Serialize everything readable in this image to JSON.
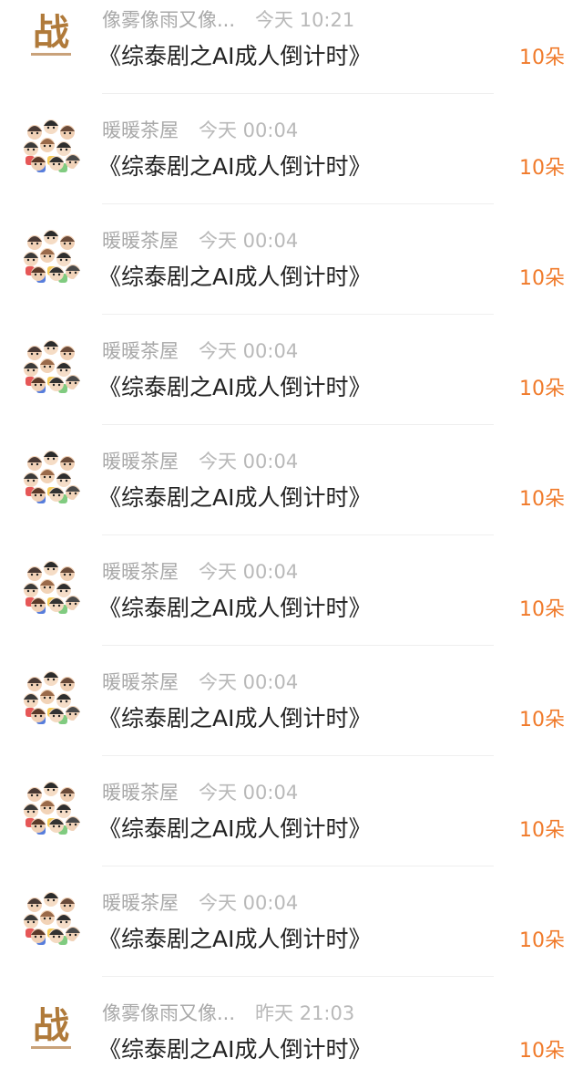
{
  "colors": {
    "amount": "#f07a2a",
    "sender": "#a9a9a9",
    "title": "#222222",
    "divider": "#efefef"
  },
  "gifts": [
    {
      "sender": "像雾像雨又像...",
      "time": "今天 10:21",
      "title": "《综泰剧之AI成人倒计时》",
      "amount": "10朵",
      "avatar": "zhan-logo"
    },
    {
      "sender": "暖暖茶屋",
      "time": "今天 00:04",
      "title": "《综泰剧之AI成人倒计时》",
      "amount": "10朵",
      "avatar": "cartoon-group"
    },
    {
      "sender": "暖暖茶屋",
      "time": "今天 00:04",
      "title": "《综泰剧之AI成人倒计时》",
      "amount": "10朵",
      "avatar": "cartoon-group"
    },
    {
      "sender": "暖暖茶屋",
      "time": "今天 00:04",
      "title": "《综泰剧之AI成人倒计时》",
      "amount": "10朵",
      "avatar": "cartoon-group"
    },
    {
      "sender": "暖暖茶屋",
      "time": "今天 00:04",
      "title": "《综泰剧之AI成人倒计时》",
      "amount": "10朵",
      "avatar": "cartoon-group"
    },
    {
      "sender": "暖暖茶屋",
      "time": "今天 00:04",
      "title": "《综泰剧之AI成人倒计时》",
      "amount": "10朵",
      "avatar": "cartoon-group"
    },
    {
      "sender": "暖暖茶屋",
      "time": "今天 00:04",
      "title": "《综泰剧之AI成人倒计时》",
      "amount": "10朵",
      "avatar": "cartoon-group"
    },
    {
      "sender": "暖暖茶屋",
      "time": "今天 00:04",
      "title": "《综泰剧之AI成人倒计时》",
      "amount": "10朵",
      "avatar": "cartoon-group"
    },
    {
      "sender": "暖暖茶屋",
      "time": "今天 00:04",
      "title": "《综泰剧之AI成人倒计时》",
      "amount": "10朵",
      "avatar": "cartoon-group"
    },
    {
      "sender": "像雾像雨又像...",
      "time": "昨天 21:03",
      "title": "《综泰剧之AI成人倒计时》",
      "amount": "10朵",
      "avatar": "zhan-logo"
    }
  ]
}
